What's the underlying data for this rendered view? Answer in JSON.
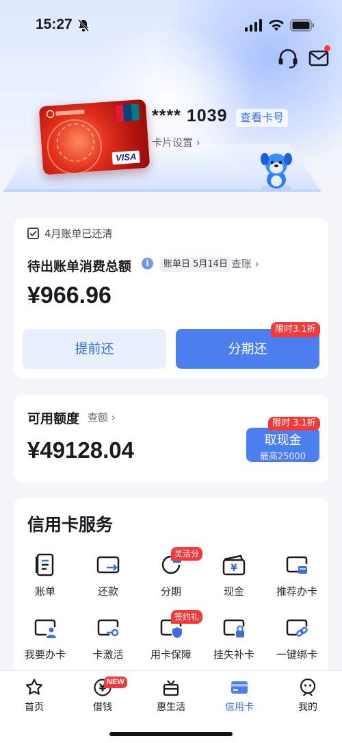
{
  "status_bar": {
    "time": "15:27",
    "icons": [
      "bell-off-icon",
      "signal-icon",
      "wifi-icon",
      "battery-icon"
    ]
  },
  "header": {
    "icons": [
      "headset-icon",
      "mail-icon"
    ]
  },
  "card": {
    "masked_number": "**** 1039",
    "view_card_label": "查看卡号",
    "settings_label": "卡片设置 ›",
    "brand_logos": [
      "UnionPay 银联",
      "VISA"
    ],
    "colors": {
      "card_red": "#d62a1b"
    }
  },
  "bill": {
    "status": "4月账单已还清",
    "pending_title": "待出账单消费总额",
    "bill_date": "账单日 5月14日",
    "view_bill": "查账 ›",
    "amount": "¥966.96",
    "prepay_label": "提前还",
    "installment_label": "分期还",
    "promo": "限时3.1折"
  },
  "credit": {
    "title": "可用额度",
    "query": "查额 ›",
    "amount": "¥49128.04",
    "cash_label": "取现金",
    "cash_sub": "最高25000",
    "promo": "限时 3.1折"
  },
  "services": {
    "title": "信用卡服务",
    "items": [
      {
        "label": "账单",
        "icon": "bill-icon",
        "badge": ""
      },
      {
        "label": "还款",
        "icon": "repay-icon",
        "badge": ""
      },
      {
        "label": "分期",
        "icon": "installment-icon",
        "badge": "灵活分"
      },
      {
        "label": "现金",
        "icon": "cash-icon",
        "badge": ""
      },
      {
        "label": "推荐办卡",
        "icon": "recommend-card-icon",
        "badge": ""
      },
      {
        "label": "我要办卡",
        "icon": "apply-card-icon",
        "badge": ""
      },
      {
        "label": "卡激活",
        "icon": "activate-card-icon",
        "badge": ""
      },
      {
        "label": "用卡保障",
        "icon": "card-protection-icon",
        "badge": "签约礼"
      },
      {
        "label": "挂失补卡",
        "icon": "report-loss-icon",
        "badge": ""
      },
      {
        "label": "一键绑卡",
        "icon": "bind-card-icon",
        "badge": ""
      }
    ]
  },
  "tabs": [
    {
      "label": "首页",
      "icon": "star-icon",
      "active": false,
      "badge": ""
    },
    {
      "label": "借钱",
      "icon": "yuan-icon",
      "active": false,
      "badge": "NEW"
    },
    {
      "label": "惠生活",
      "icon": "gift-box-icon",
      "active": false,
      "badge": ""
    },
    {
      "label": "信用卡",
      "icon": "credit-card-icon",
      "active": true,
      "badge": ""
    },
    {
      "label": "我的",
      "icon": "profile-icon",
      "active": false,
      "badge": ""
    }
  ],
  "colors": {
    "accent": "#4b7ff0",
    "promo_red": "#f23a3a",
    "background": "#f4f5f8"
  }
}
